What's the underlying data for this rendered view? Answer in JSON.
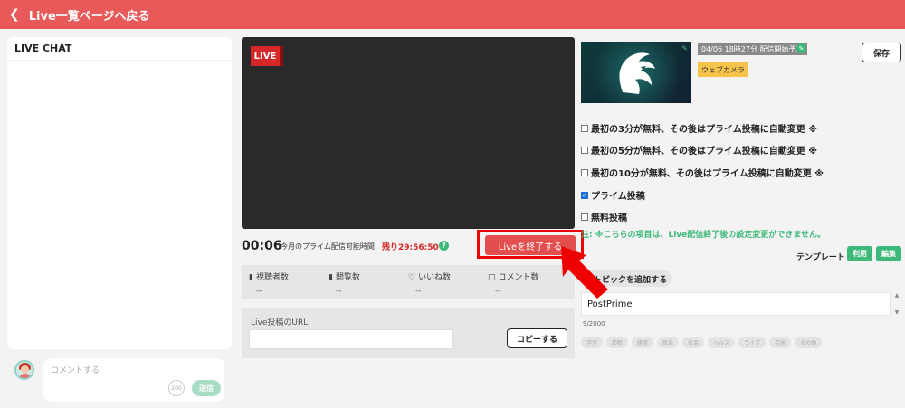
{
  "header": {
    "back_label": "Live一覧ページへ戻る"
  },
  "chat": {
    "title": "LIVE CHAT",
    "placeholder": "コメントする",
    "counter": "200",
    "send_label": "送信"
  },
  "video": {
    "live_badge": "LIVE"
  },
  "status": {
    "elapsed": "00:06",
    "prime_label": "今月のプライム配信可能時間",
    "remaining": "残り29:56:50",
    "help": "?",
    "end_button": "Liveを終了する"
  },
  "stats": [
    {
      "label": "視聴者数",
      "value": "--"
    },
    {
      "label": "閲覧数",
      "value": "--"
    },
    {
      "label": "いいね数",
      "value": "--"
    },
    {
      "label": "コメント数",
      "value": "--"
    }
  ],
  "url": {
    "label": "Live投稿のURL",
    "value": "",
    "copy_label": "コピーする"
  },
  "post": {
    "date_tag": "04/06 18時27分 配信開始予定",
    "source_tag": "ウェブカメラ",
    "save_label": "保存",
    "options": [
      {
        "label": "最初の3分が無料、その後はプライム投稿に自動変更 ※",
        "checked": false
      },
      {
        "label": "最初の5分が無料、その後はプライム投稿に自動変更 ※",
        "checked": false
      },
      {
        "label": "最初の10分が無料、その後はプライム投稿に自動変更 ※",
        "checked": false
      },
      {
        "label": "プライム投稿",
        "checked": true
      },
      {
        "label": "無料投稿",
        "checked": false
      }
    ],
    "note": "注: ※こちらの項目は、Live配信終了後の設定変更ができません。",
    "template_label": "テンプレート",
    "use_label": "利用",
    "edit_label": "編集",
    "topic_label": "トピックを追加する",
    "title_value": "PostPrime",
    "char_count": "9/2000",
    "tags": [
      "学び",
      "節税",
      "経済",
      "政治",
      "社会",
      "ヘルス",
      "ライブ",
      "芸術",
      "その他"
    ]
  },
  "colors": {
    "accent": "#e85a5a",
    "green": "#3cb878",
    "live_red": "#d62828"
  }
}
